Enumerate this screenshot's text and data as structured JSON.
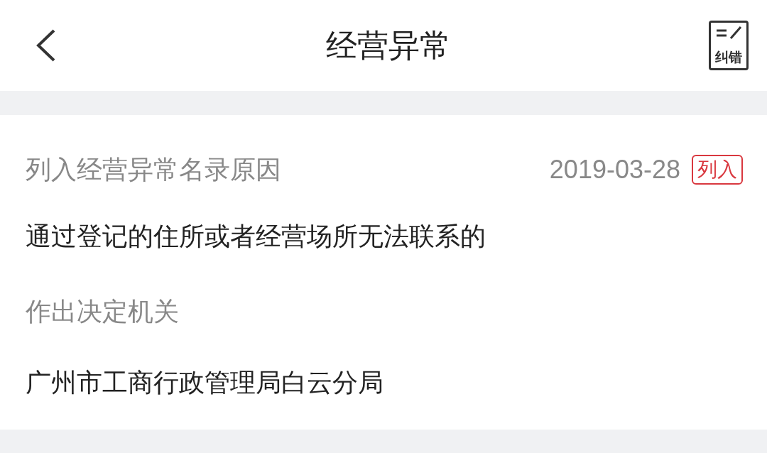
{
  "header": {
    "title": "经营异常",
    "correct_button": "纠错"
  },
  "record": {
    "reason_label": "列入经营异常名录原因",
    "date": "2019-03-28",
    "tag": "列入",
    "reason": "通过登记的住所或者经营场所无法联系的",
    "authority_label": "作出决定机关",
    "authority": "广州市工商行政管理局白云分局"
  }
}
